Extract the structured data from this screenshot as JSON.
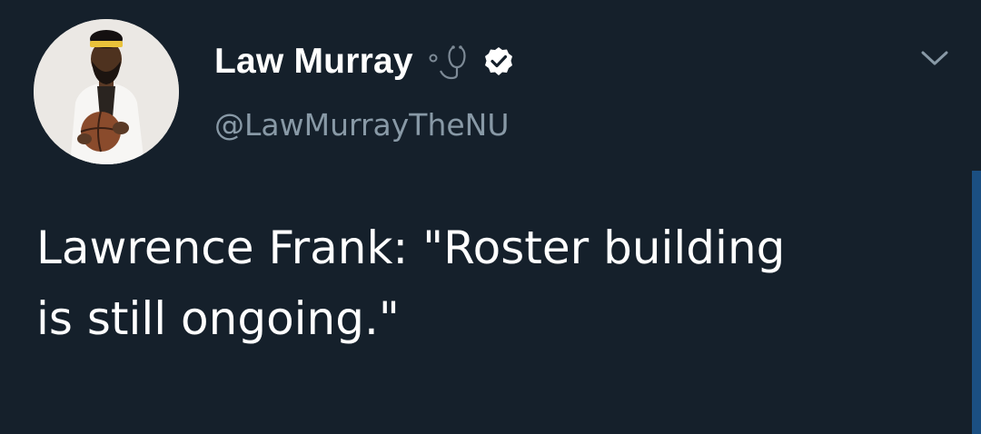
{
  "tweet": {
    "author": {
      "display_name": "Law Murray",
      "handle": "@LawMurrayTheNU",
      "verified": true,
      "name_emoji": "stethoscope-icon",
      "avatar": "profile-photo"
    },
    "text": "Lawrence Frank: \"Roster building\nis still ongoing.\"",
    "menu_icon": "chevron-down-icon"
  },
  "colors": {
    "background": "#15202b",
    "text": "#ffffff",
    "handle": "#8899a6",
    "scrollbar": "#1b4f82"
  }
}
